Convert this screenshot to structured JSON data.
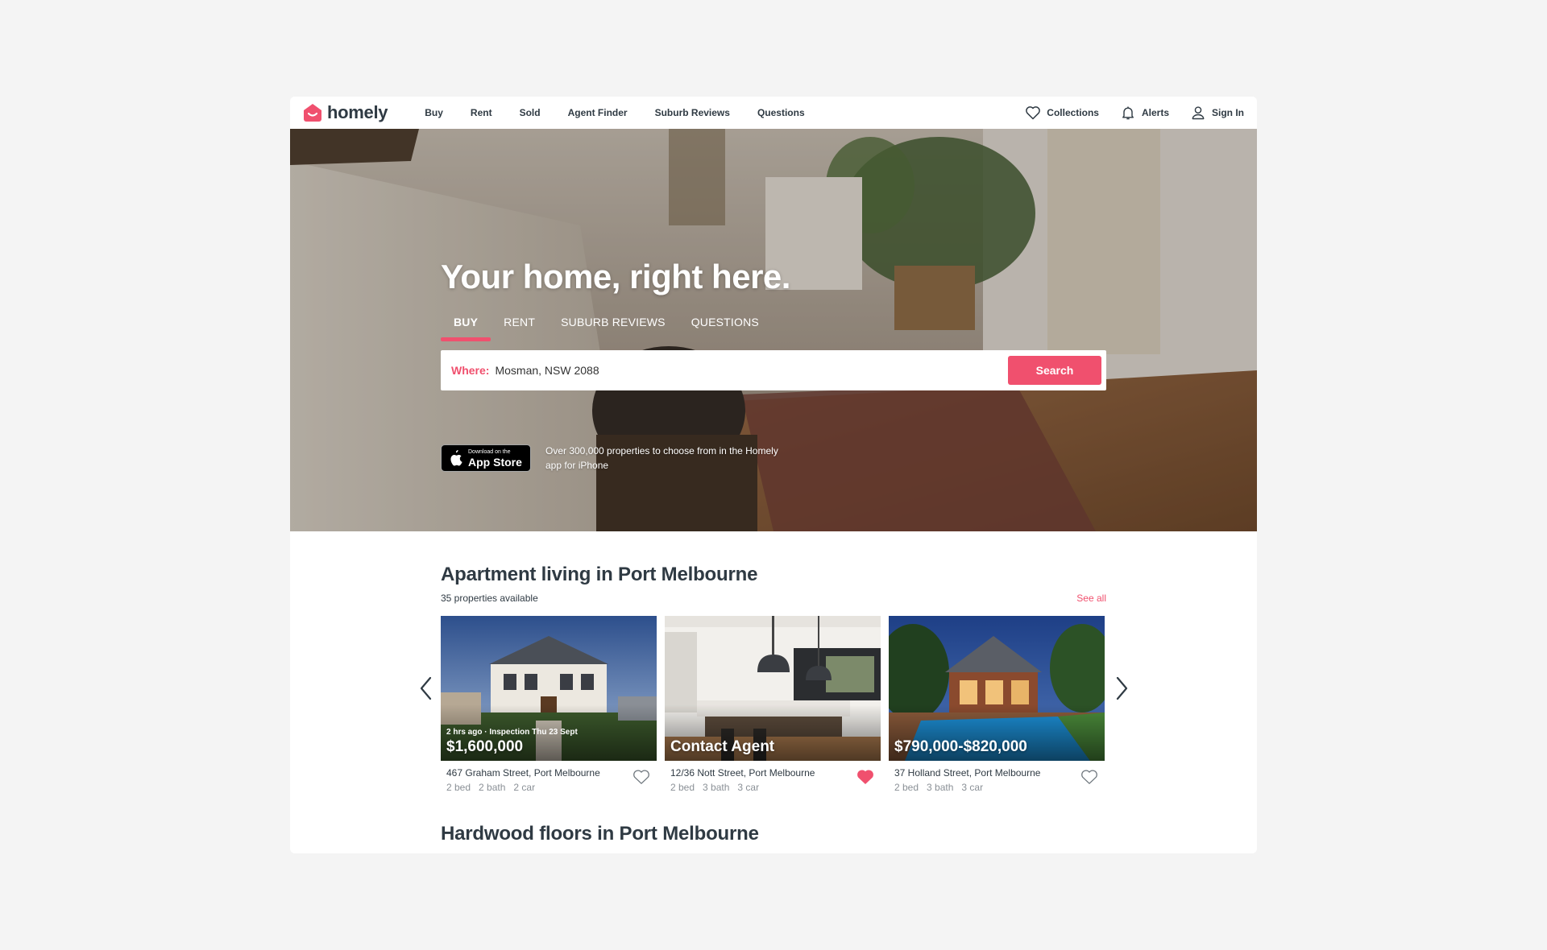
{
  "brand": {
    "name": "homely",
    "color": "#f0506e"
  },
  "nav": {
    "links": [
      "Buy",
      "Rent",
      "Sold",
      "Agent Finder",
      "Suburb Reviews",
      "Questions"
    ],
    "actions": {
      "collections": "Collections",
      "alerts": "Alerts",
      "sign_in": "Sign In"
    }
  },
  "hero": {
    "title": "Your home, right here.",
    "tabs": [
      "BUY",
      "RENT",
      "SUBURB REVIEWS",
      "QUESTIONS"
    ],
    "active_tab": "BUY",
    "search": {
      "label": "Where:",
      "value": "Mosman, NSW 2088",
      "button": "Search"
    },
    "app_promo": {
      "badge_small": "Download on the",
      "badge_big": "App Store",
      "text": "Over 300,000 properties to choose from in the Homely app for iPhone"
    }
  },
  "section1": {
    "title": "Apartment living in Port Melbourne",
    "count": "35 properties available",
    "see_all": "See all",
    "cards": [
      {
        "meta": "2 hrs ago · Inspection Thu 23 Sept",
        "price": "$1,600,000",
        "address": "467 Graham Street, Port Melbourne",
        "bed": "2 bed",
        "bath": "2 bath",
        "car": "2 car",
        "favorited": false
      },
      {
        "meta": "",
        "price": "Contact Agent",
        "address": "12/36 Nott Street, Port Melbourne",
        "bed": "2 bed",
        "bath": "3 bath",
        "car": "3 car",
        "favorited": true
      },
      {
        "meta": "",
        "price": "$790,000-$820,000",
        "address": "37 Holland Street, Port Melbourne",
        "bed": "2 bed",
        "bath": "3 bath",
        "car": "3 car",
        "favorited": false
      }
    ]
  },
  "section2": {
    "title": "Hardwood floors in Port Melbourne"
  }
}
